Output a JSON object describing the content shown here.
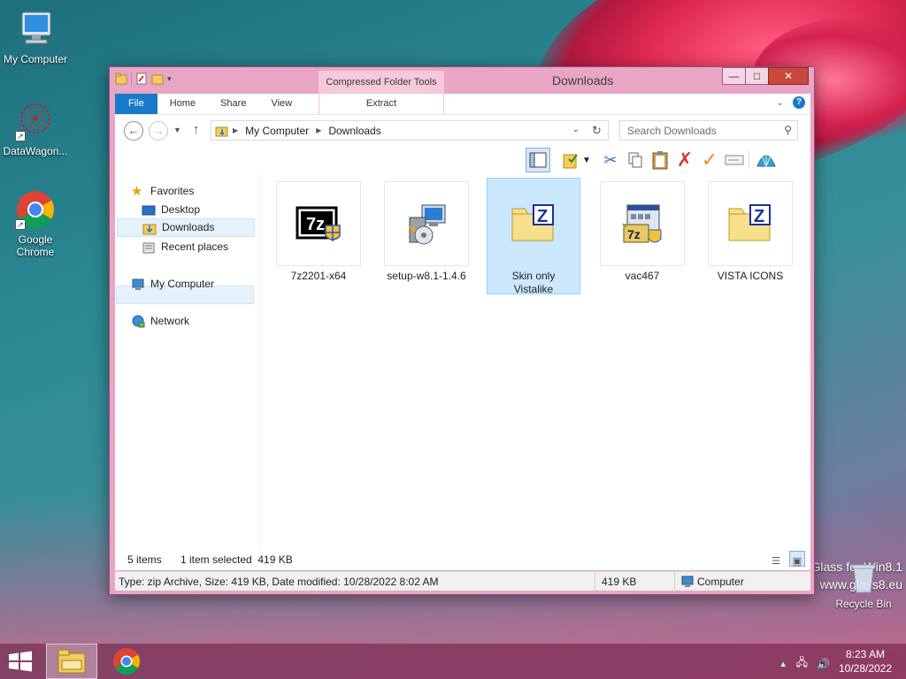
{
  "desktop": {
    "icons": [
      {
        "label": "My Computer"
      },
      {
        "label": "DataWagon..."
      },
      {
        "label": "Google Chrome"
      },
      {
        "label": "Recycle Bin"
      }
    ],
    "watermark_line1": "Glass for Win8.1",
    "watermark_line2": "www.glass8.eu"
  },
  "window": {
    "title": "Downloads",
    "context_tab_header": "Compressed Folder Tools",
    "ribbon_tabs": {
      "file": "File",
      "home": "Home",
      "share": "Share",
      "view": "View",
      "extract": "Extract"
    },
    "controls": {
      "minimize": "—",
      "maximize": "□",
      "close": "✕"
    }
  },
  "navigation": {
    "breadcrumb": [
      "My Computer",
      "Downloads"
    ],
    "search_placeholder": "Search Downloads"
  },
  "nav_pane": {
    "favorites": "Favorites",
    "desktop": "Desktop",
    "downloads": "Downloads",
    "recent_places": "Recent places",
    "my_computer": "My Computer",
    "network": "Network"
  },
  "files": [
    {
      "name": "7z2201-x64",
      "icon": "7zip-installer-icon",
      "selected": false
    },
    {
      "name": "setup-w8.1-1.4.6",
      "icon": "setup-installer-icon",
      "selected": false
    },
    {
      "name": "Skin only Vistalike",
      "icon": "zip-folder-icon",
      "selected": true
    },
    {
      "name": "vac467",
      "icon": "7z-archive-app-icon",
      "selected": false
    },
    {
      "name": "VISTA ICONS",
      "icon": "zip-folder-icon",
      "selected": false
    }
  ],
  "status": {
    "item_count": "5 items",
    "selection": "1 item selected  419 KB"
  },
  "details": {
    "info": "Type: zip Archive, Size: 419 KB, Date modified: 10/28/2022 8:02 AM",
    "size": "419 KB",
    "location": "Computer"
  },
  "taskbar": {
    "time": "8:23 AM",
    "date": "10/28/2022"
  },
  "colors": {
    "accent": "#1979ca",
    "window_frame": "#e8a5c4",
    "taskbar": "#8c375f",
    "selection": "#cce8ff"
  }
}
